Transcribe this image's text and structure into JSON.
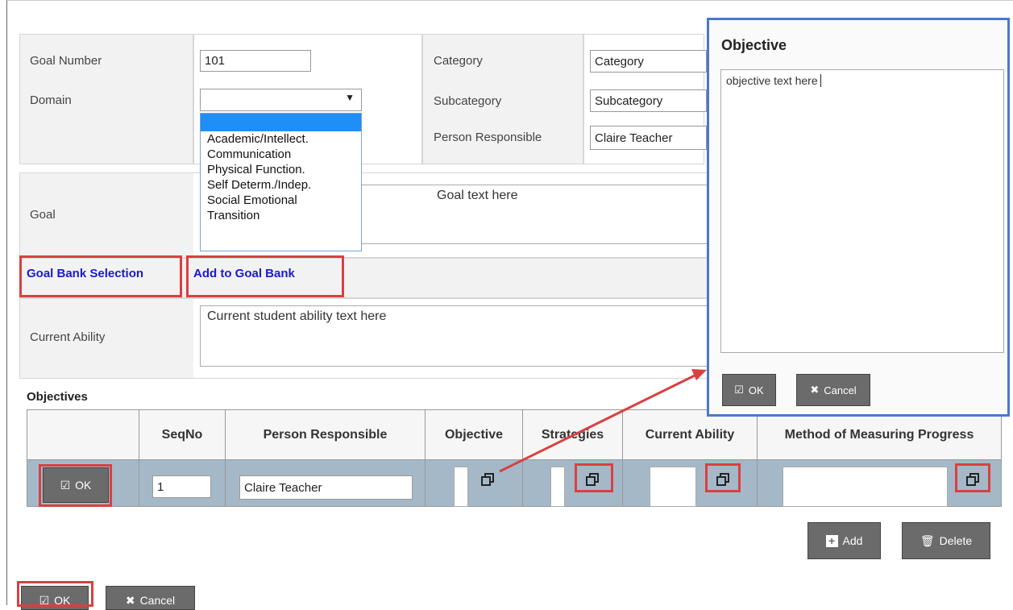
{
  "form": {
    "goal_number_label": "Goal Number",
    "goal_number_value": "101",
    "domain_label": "Domain",
    "domain_value": "",
    "domain_options": [
      "Academic/Intellect.",
      "Communication",
      "Physical Function.",
      "Self Determ./Indep.",
      "Social Emotional",
      "Transition"
    ],
    "category_label": "Category",
    "category_value": "Category",
    "subcategory_label": "Subcategory",
    "subcategory_value": "Subcategory",
    "person_responsible_label": "Person Responsible",
    "person_responsible_value": "Claire Teacher",
    "goal_label": "Goal",
    "goal_text": "Goal text here",
    "goal_bank_selection": "Goal Bank Selection",
    "add_to_goal_bank": "Add to Goal Bank",
    "current_ability_label": "Current Ability",
    "current_ability_text": "Current student ability text here"
  },
  "objectives": {
    "title": "Objectives",
    "columns": [
      "",
      "SeqNo",
      "Person Responsible",
      "Objective",
      "Strategies",
      "Current Ability",
      "Method of Measuring Progress"
    ],
    "row": {
      "ok_label": "OK",
      "seqno": "1",
      "person": "Claire Teacher"
    },
    "add_label": "Add",
    "delete_label": "Delete"
  },
  "footer": {
    "ok_label": "OK",
    "cancel_label": "Cancel"
  },
  "modal": {
    "title": "Objective",
    "text": "objective text here",
    "ok_label": "OK",
    "cancel_label": "Cancel"
  },
  "colors": {
    "highlight": "#d94040",
    "modal_border": "#4a78d0",
    "link": "#1a1ad0",
    "row_bg": "#a4b8c8",
    "button_bg": "#6b6b6b"
  }
}
